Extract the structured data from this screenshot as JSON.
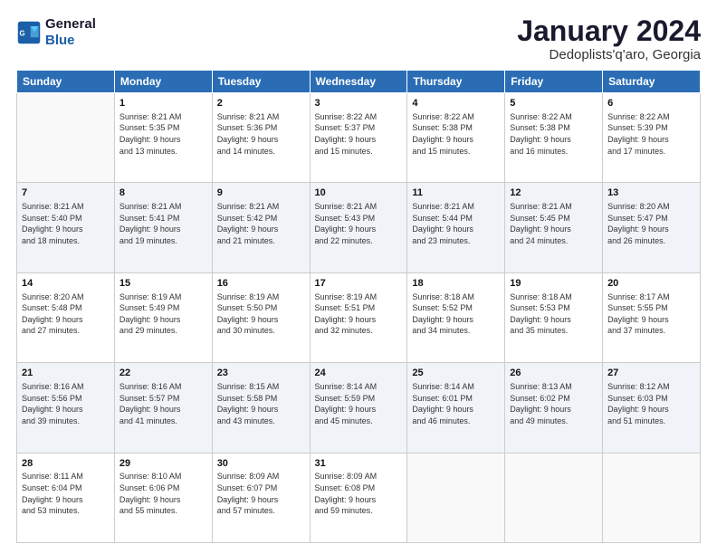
{
  "logo": {
    "line1": "General",
    "line2": "Blue"
  },
  "title": "January 2024",
  "subtitle": "Dedoplists'q'aro, Georgia",
  "weekdays": [
    "Sunday",
    "Monday",
    "Tuesday",
    "Wednesday",
    "Thursday",
    "Friday",
    "Saturday"
  ],
  "weeks": [
    [
      {
        "day": "",
        "info": ""
      },
      {
        "day": "1",
        "info": "Sunrise: 8:21 AM\nSunset: 5:35 PM\nDaylight: 9 hours\nand 13 minutes."
      },
      {
        "day": "2",
        "info": "Sunrise: 8:21 AM\nSunset: 5:36 PM\nDaylight: 9 hours\nand 14 minutes."
      },
      {
        "day": "3",
        "info": "Sunrise: 8:22 AM\nSunset: 5:37 PM\nDaylight: 9 hours\nand 15 minutes."
      },
      {
        "day": "4",
        "info": "Sunrise: 8:22 AM\nSunset: 5:38 PM\nDaylight: 9 hours\nand 15 minutes."
      },
      {
        "day": "5",
        "info": "Sunrise: 8:22 AM\nSunset: 5:38 PM\nDaylight: 9 hours\nand 16 minutes."
      },
      {
        "day": "6",
        "info": "Sunrise: 8:22 AM\nSunset: 5:39 PM\nDaylight: 9 hours\nand 17 minutes."
      }
    ],
    [
      {
        "day": "7",
        "info": "Sunrise: 8:21 AM\nSunset: 5:40 PM\nDaylight: 9 hours\nand 18 minutes."
      },
      {
        "day": "8",
        "info": "Sunrise: 8:21 AM\nSunset: 5:41 PM\nDaylight: 9 hours\nand 19 minutes."
      },
      {
        "day": "9",
        "info": "Sunrise: 8:21 AM\nSunset: 5:42 PM\nDaylight: 9 hours\nand 21 minutes."
      },
      {
        "day": "10",
        "info": "Sunrise: 8:21 AM\nSunset: 5:43 PM\nDaylight: 9 hours\nand 22 minutes."
      },
      {
        "day": "11",
        "info": "Sunrise: 8:21 AM\nSunset: 5:44 PM\nDaylight: 9 hours\nand 23 minutes."
      },
      {
        "day": "12",
        "info": "Sunrise: 8:21 AM\nSunset: 5:45 PM\nDaylight: 9 hours\nand 24 minutes."
      },
      {
        "day": "13",
        "info": "Sunrise: 8:20 AM\nSunset: 5:47 PM\nDaylight: 9 hours\nand 26 minutes."
      }
    ],
    [
      {
        "day": "14",
        "info": "Sunrise: 8:20 AM\nSunset: 5:48 PM\nDaylight: 9 hours\nand 27 minutes."
      },
      {
        "day": "15",
        "info": "Sunrise: 8:19 AM\nSunset: 5:49 PM\nDaylight: 9 hours\nand 29 minutes."
      },
      {
        "day": "16",
        "info": "Sunrise: 8:19 AM\nSunset: 5:50 PM\nDaylight: 9 hours\nand 30 minutes."
      },
      {
        "day": "17",
        "info": "Sunrise: 8:19 AM\nSunset: 5:51 PM\nDaylight: 9 hours\nand 32 minutes."
      },
      {
        "day": "18",
        "info": "Sunrise: 8:18 AM\nSunset: 5:52 PM\nDaylight: 9 hours\nand 34 minutes."
      },
      {
        "day": "19",
        "info": "Sunrise: 8:18 AM\nSunset: 5:53 PM\nDaylight: 9 hours\nand 35 minutes."
      },
      {
        "day": "20",
        "info": "Sunrise: 8:17 AM\nSunset: 5:55 PM\nDaylight: 9 hours\nand 37 minutes."
      }
    ],
    [
      {
        "day": "21",
        "info": "Sunrise: 8:16 AM\nSunset: 5:56 PM\nDaylight: 9 hours\nand 39 minutes."
      },
      {
        "day": "22",
        "info": "Sunrise: 8:16 AM\nSunset: 5:57 PM\nDaylight: 9 hours\nand 41 minutes."
      },
      {
        "day": "23",
        "info": "Sunrise: 8:15 AM\nSunset: 5:58 PM\nDaylight: 9 hours\nand 43 minutes."
      },
      {
        "day": "24",
        "info": "Sunrise: 8:14 AM\nSunset: 5:59 PM\nDaylight: 9 hours\nand 45 minutes."
      },
      {
        "day": "25",
        "info": "Sunrise: 8:14 AM\nSunset: 6:01 PM\nDaylight: 9 hours\nand 46 minutes."
      },
      {
        "day": "26",
        "info": "Sunrise: 8:13 AM\nSunset: 6:02 PM\nDaylight: 9 hours\nand 49 minutes."
      },
      {
        "day": "27",
        "info": "Sunrise: 8:12 AM\nSunset: 6:03 PM\nDaylight: 9 hours\nand 51 minutes."
      }
    ],
    [
      {
        "day": "28",
        "info": "Sunrise: 8:11 AM\nSunset: 6:04 PM\nDaylight: 9 hours\nand 53 minutes."
      },
      {
        "day": "29",
        "info": "Sunrise: 8:10 AM\nSunset: 6:06 PM\nDaylight: 9 hours\nand 55 minutes."
      },
      {
        "day": "30",
        "info": "Sunrise: 8:09 AM\nSunset: 6:07 PM\nDaylight: 9 hours\nand 57 minutes."
      },
      {
        "day": "31",
        "info": "Sunrise: 8:09 AM\nSunset: 6:08 PM\nDaylight: 9 hours\nand 59 minutes."
      },
      {
        "day": "",
        "info": ""
      },
      {
        "day": "",
        "info": ""
      },
      {
        "day": "",
        "info": ""
      }
    ]
  ]
}
